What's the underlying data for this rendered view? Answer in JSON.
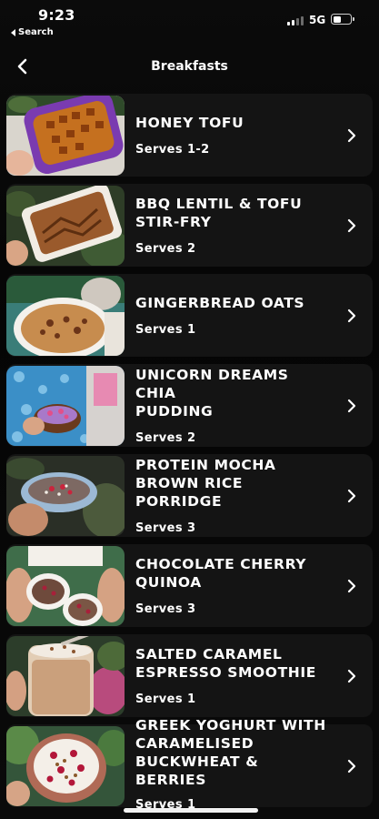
{
  "status_bar": {
    "time": "9:23",
    "back_app_label": "Search",
    "network": "5G"
  },
  "header": {
    "title": "Breakfasts",
    "back_icon": "chevron-left-icon"
  },
  "recipes": [
    {
      "name": "HONEY TOFU",
      "serves": "Serves 1-2"
    },
    {
      "name": "BBQ LENTIL & TOFU\nSTIR-FRY",
      "serves": "Serves 2"
    },
    {
      "name": "GINGERBREAD OATS",
      "serves": "Serves 1"
    },
    {
      "name": "UNICORN DREAMS CHIA\nPUDDING",
      "serves": "Serves 2"
    },
    {
      "name": "PROTEIN MOCHA\nBROWN RICE PORRIDGE",
      "serves": "Serves 3"
    },
    {
      "name": "CHOCOLATE CHERRY\nQUINOA",
      "serves": "Serves 3"
    },
    {
      "name": "SALTED CARAMEL\nESPRESSO SMOOTHIE",
      "serves": "Serves 1"
    },
    {
      "name": "GREEK YOGHURT WITH\nCARAMELISED\nBUCKWHEAT & BERRIES",
      "serves": "Serves 1"
    }
  ],
  "row_icon": "chevron-right-icon"
}
